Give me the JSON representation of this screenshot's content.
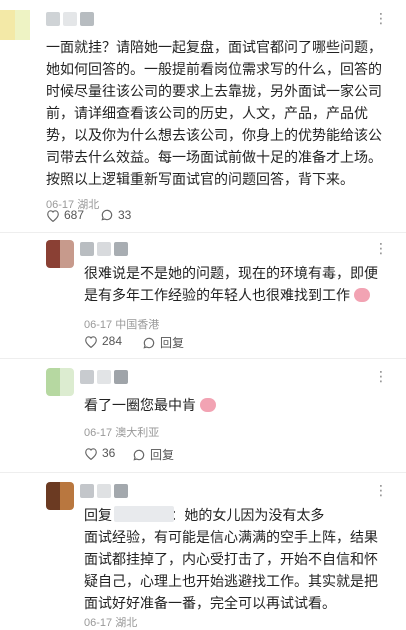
{
  "comments": [
    {
      "text_lines": [
        "一面就挂？请陪她一起复盘，面试官都问了哪些问题，",
        "她如何回答的。一般提前看岗位需求写的什么，回答的",
        "时候尽量往该公司的要求上去靠拢，另外面试一家公司",
        "前，请详细查看该公司的历史，人文，产品，产品优",
        "势，以及你为什么想去该公司，你身上的优势能给该公",
        "司带去什么效益。每一场面试前做十足的准备才上场。",
        "按照以上逻辑重新写面试官的问题回答，背下来。"
      ],
      "meta": "06-17 湖北",
      "likes": "687",
      "replies": "33"
    },
    {
      "text_lines": [
        "很难说是不是她的问题，现在的环境有毒，即便",
        "是有多年工作经验的年轻人也很难找到工作"
      ],
      "meta": "06-17 中国香港",
      "likes": "284",
      "reply_label": "回复"
    },
    {
      "text_lines": [
        "看了一圈您最中肯"
      ],
      "meta": "06-17 澳大利亚",
      "likes": "36",
      "reply_label": "回复"
    },
    {
      "text_lines": [
        "回复               ：她的女儿因为没有太多",
        "面试经验，有可能是信心满满的空手上阵，结果",
        "面试都挂掉了，内心受打击了，开始不自信和怀",
        "疑自己，心理上也开始逃避找工作。其实就是把",
        "面试好好准备一番，完全可以再试试看。"
      ],
      "meta": "06-17 湖北"
    }
  ],
  "more_icon": "⋮",
  "colors": {
    "text": "#222222",
    "meta": "#999999",
    "divider": "#eeeeee"
  }
}
